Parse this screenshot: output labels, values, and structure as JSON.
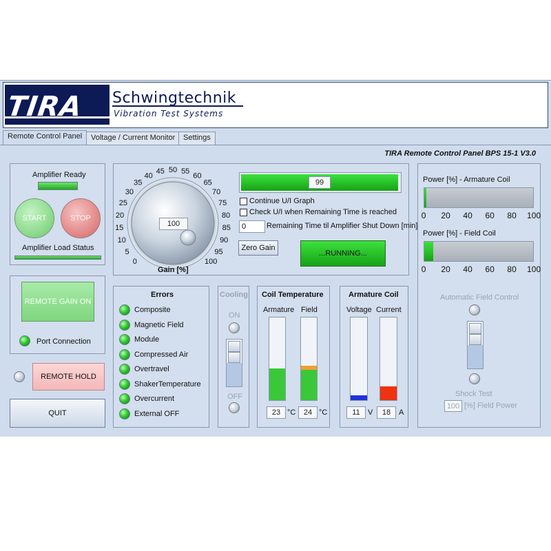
{
  "header": {
    "logo": "TIRA",
    "brand_name": "Schwingtechnik",
    "brand_sub": "Vibration Test Systems"
  },
  "tabs": [
    "Remote Control Panel",
    "Voltage / Current Monitor",
    "Settings"
  ],
  "panel_title": "TIRA Remote Control Panel BPS 15-1 V3.0",
  "amplifier": {
    "ready_label": "Amplifier Ready",
    "start_label": "START",
    "stop_label": "STOP",
    "load_status_label": "Amplifier Load Status"
  },
  "remote": {
    "gain_on_label": "REMOTE GAIN ON",
    "port_connection_label": "Port Connection",
    "hold_label": "REMOTE HOLD",
    "quit_label": "QUIT"
  },
  "gain": {
    "label": "Gain [%]",
    "value": "100",
    "ticks": [
      "0",
      "5",
      "10",
      "15",
      "20",
      "25",
      "30",
      "35",
      "40",
      "45",
      "50",
      "55",
      "60",
      "65",
      "70",
      "75",
      "80",
      "85",
      "90",
      "95",
      "100"
    ],
    "progress_value": "99",
    "progress_fraction": 0.99,
    "continue_graph_label": "Continue U/I Graph",
    "check_ui_label": "Check U/I when Remaining Time is reached",
    "remaining_time_value": "0",
    "remaining_time_label": "Remaining Time til Amplifier Shut Down [min]",
    "zero_gain_label": "Zero Gain",
    "running_label": "...RUNNING..."
  },
  "errors": {
    "title": "Errors",
    "items": [
      "Composite",
      "Magnetic Field",
      "Module",
      "Compressed Air",
      "Overtravel",
      "ShakerTemperature",
      "Overcurrent",
      "External OFF"
    ]
  },
  "cooling": {
    "title": "Cooling",
    "on_label": "ON",
    "off_label": "OFF"
  },
  "coil_temperature": {
    "title": "Coil Temperature",
    "armature_label": "Armature",
    "field_label": "Field",
    "armature_value": "23",
    "field_value": "24",
    "unit": "°C",
    "armature_fraction": 0.38,
    "field_fraction": 0.42
  },
  "armature_coil": {
    "title": "Armature Coil",
    "voltage_label": "Voltage",
    "current_label": "Current",
    "voltage_value": "11",
    "current_value": "18",
    "voltage_unit": "V",
    "current_unit": "A",
    "voltage_fraction": 0.06,
    "current_fraction": 0.17
  },
  "power": {
    "armature_title": "Power [%] - Armature Coil",
    "field_title": "Power [%] - Field Coil",
    "armature_fraction": 0.02,
    "field_fraction": 0.08,
    "ticks": [
      "0",
      "20",
      "40",
      "60",
      "80",
      "100"
    ]
  },
  "field_control": {
    "auto_label": "Automatic Field Control",
    "shock_test_label": "Shock Test",
    "field_power_value": "100",
    "field_power_label": "[%] Field Power"
  },
  "colors": {
    "accent_green": "#1fb81f",
    "stop_red": "#e48a8a",
    "start_green": "#8fdc8f",
    "armature_fill": "#3ac83a",
    "field_accent": "#f0a030",
    "voltage_fill": "#2233dd",
    "current_fill": "#ee3311"
  }
}
